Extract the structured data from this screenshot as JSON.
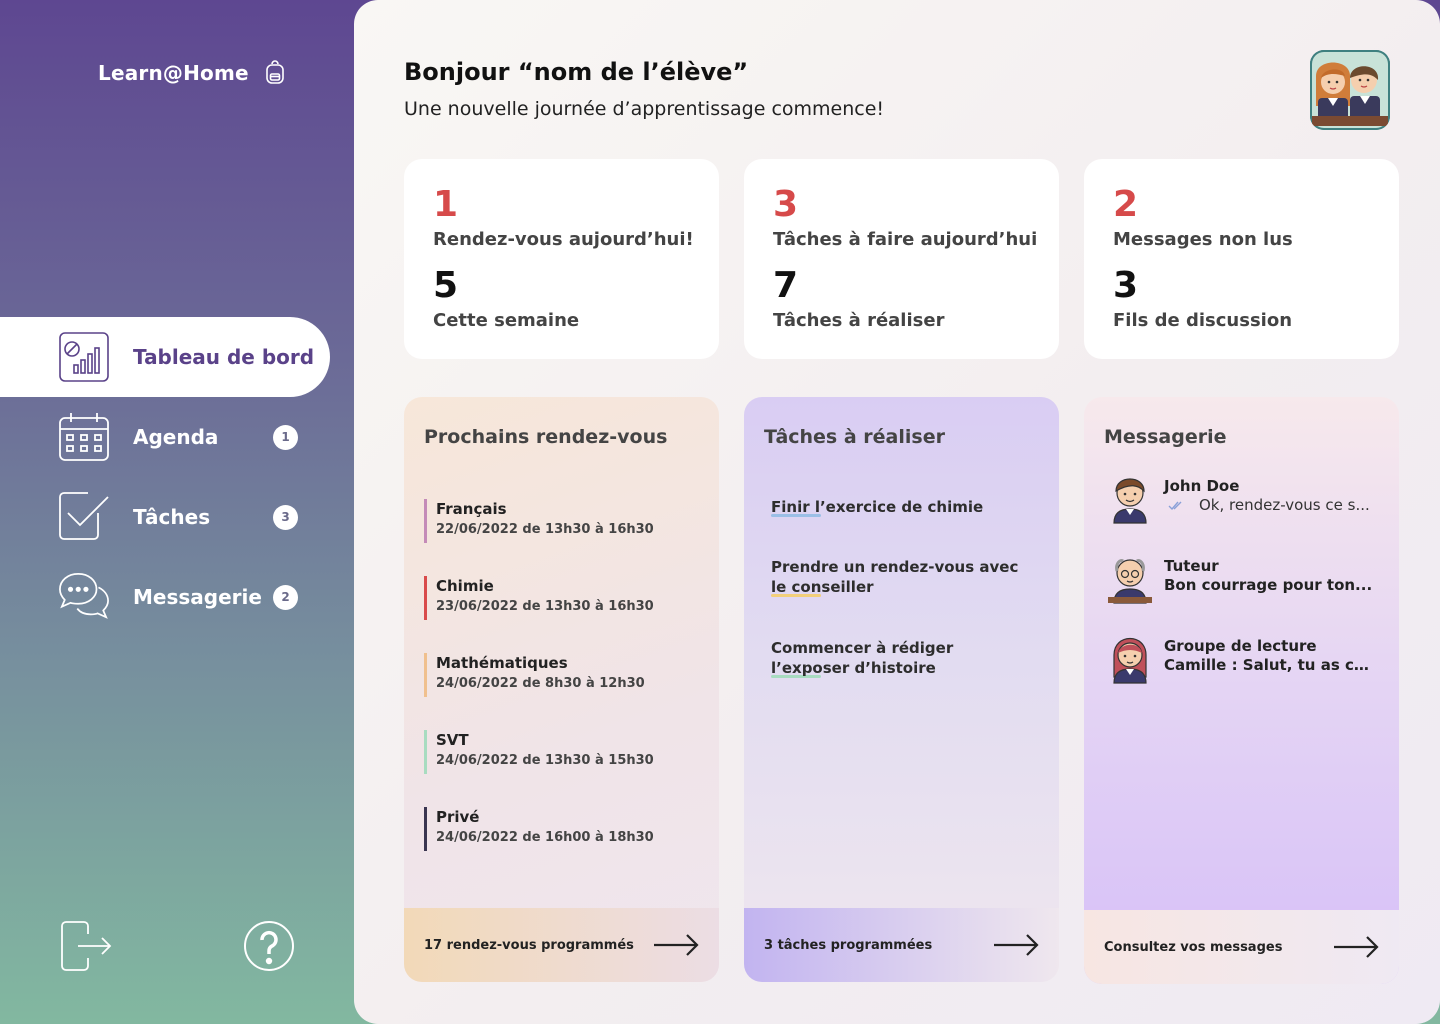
{
  "sidebar": {
    "brand": "Learn@Home",
    "items": [
      {
        "label": "Tableau de bord",
        "icon": "dashboard-icon",
        "badge": ""
      },
      {
        "label": "Agenda",
        "icon": "calendar-icon",
        "badge": "1"
      },
      {
        "label": "Tâches",
        "icon": "checkbox-icon",
        "badge": "3"
      },
      {
        "label": "Messagerie",
        "icon": "chat-icon",
        "badge": "2"
      }
    ],
    "bottom": {
      "logout_icon": "logout-icon",
      "help_icon": "help-icon"
    }
  },
  "header": {
    "greeting": "Bonjour “nom de l’élève”",
    "subtitle": "Une nouvelle journée d’apprentissage commence!"
  },
  "stats": [
    {
      "top_value": "1",
      "top_label": "Rendez-vous aujourd’hui!",
      "bottom_value": "5",
      "bottom_label": "Cette semaine"
    },
    {
      "top_value": "3",
      "top_label": "Tâches à faire aujourd’hui",
      "bottom_value": "7",
      "bottom_label": "Tâches à réaliser"
    },
    {
      "top_value": "2",
      "top_label": "Messages non lus",
      "bottom_value": "3",
      "bottom_label": "Fils de discussion"
    }
  ],
  "appointments": {
    "title": "Prochains rendez-vous",
    "items": [
      {
        "subject": "Français",
        "when": "22/06/2022 de 13h30 à 16h30",
        "color": "#c48bb8"
      },
      {
        "subject": "Chimie",
        "when": "23/06/2022 de 13h30 à 16h30",
        "color": "#d94b4b"
      },
      {
        "subject": "Mathématiques",
        "when": "24/06/2022 de 8h30 à 12h30",
        "color": "#f0c08e"
      },
      {
        "subject": "SVT",
        "when": "24/06/2022 de 13h30 à 15h30",
        "color": "#a8dcc0"
      },
      {
        "subject": "Privé",
        "when": "24/06/2022 de 16h00 à 18h30",
        "color": "#3a3550"
      }
    ],
    "footer": "17 rendez-vous programmés"
  },
  "tasks": {
    "title": "Tâches à réaliser",
    "items": [
      {
        "label": "Finir l’exercice de chimie",
        "color": "#9bbfe6"
      },
      {
        "label": "Prendre un rendez-vous avec le conseiller",
        "color": "#f2cf7a"
      },
      {
        "label": "Commencer à rédiger l’exposer d’histoire",
        "color": "#a8dcc0"
      }
    ],
    "footer": "3 tâches programmées"
  },
  "messages": {
    "title": "Messagerie",
    "items": [
      {
        "name": "John Doe",
        "preview": "Ok, rendez-vous ce s...",
        "avatar": "boy-avatar-icon"
      },
      {
        "name": "Tuteur",
        "preview": "Bon courrage pour ton...",
        "avatar": "old-man-avatar-icon"
      },
      {
        "name": "Groupe de lecture",
        "preview": "Camille : Salut, tu as co...",
        "avatar": "girl-avatar-icon"
      }
    ],
    "footer": "Consultez vos messages"
  },
  "colors": {
    "accent": "#5a4289",
    "highlight": "#d64a4a"
  }
}
